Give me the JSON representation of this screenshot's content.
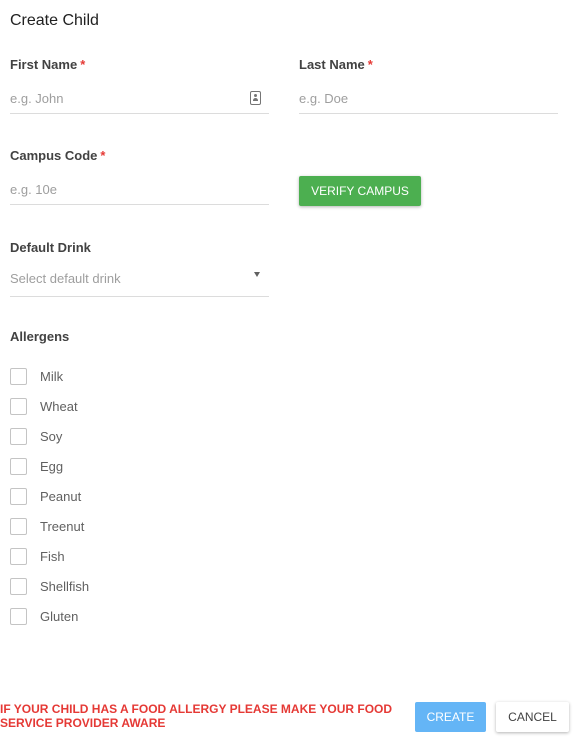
{
  "dialog": {
    "title": "Create Child"
  },
  "first_name": {
    "label": "First Name",
    "required_mark": "*",
    "placeholder": "e.g. John",
    "value": ""
  },
  "last_name": {
    "label": "Last Name",
    "required_mark": "*",
    "placeholder": "e.g. Doe",
    "value": ""
  },
  "campus_code": {
    "label": "Campus Code",
    "required_mark": "*",
    "placeholder": "e.g. 10e",
    "value": ""
  },
  "verify_button": {
    "label": "VERIFY CAMPUS"
  },
  "default_drink": {
    "label": "Default Drink",
    "selected": "Select default drink"
  },
  "allergens": {
    "label": "Allergens",
    "items": [
      {
        "label": "Milk",
        "checked": false
      },
      {
        "label": "Wheat",
        "checked": false
      },
      {
        "label": "Soy",
        "checked": false
      },
      {
        "label": "Egg",
        "checked": false
      },
      {
        "label": "Peanut",
        "checked": false
      },
      {
        "label": "Treenut",
        "checked": false
      },
      {
        "label": "Fish",
        "checked": false
      },
      {
        "label": "Shellfish",
        "checked": false
      },
      {
        "label": "Gluten",
        "checked": false
      }
    ]
  },
  "footer": {
    "warning": "IF YOUR CHILD HAS A FOOD ALLERGY PLEASE MAKE YOUR FOOD SERVICE PROVIDER AWARE",
    "create_label": "CREATE",
    "cancel_label": "CANCEL"
  },
  "colors": {
    "verify_green": "#4caf50",
    "create_blue": "#64b5f6",
    "required_red": "#e53935",
    "warning_red": "#e53935"
  },
  "icons": {
    "first_name_field": "contact-card-icon",
    "default_drink_select": "dropdown-arrow-icon"
  }
}
